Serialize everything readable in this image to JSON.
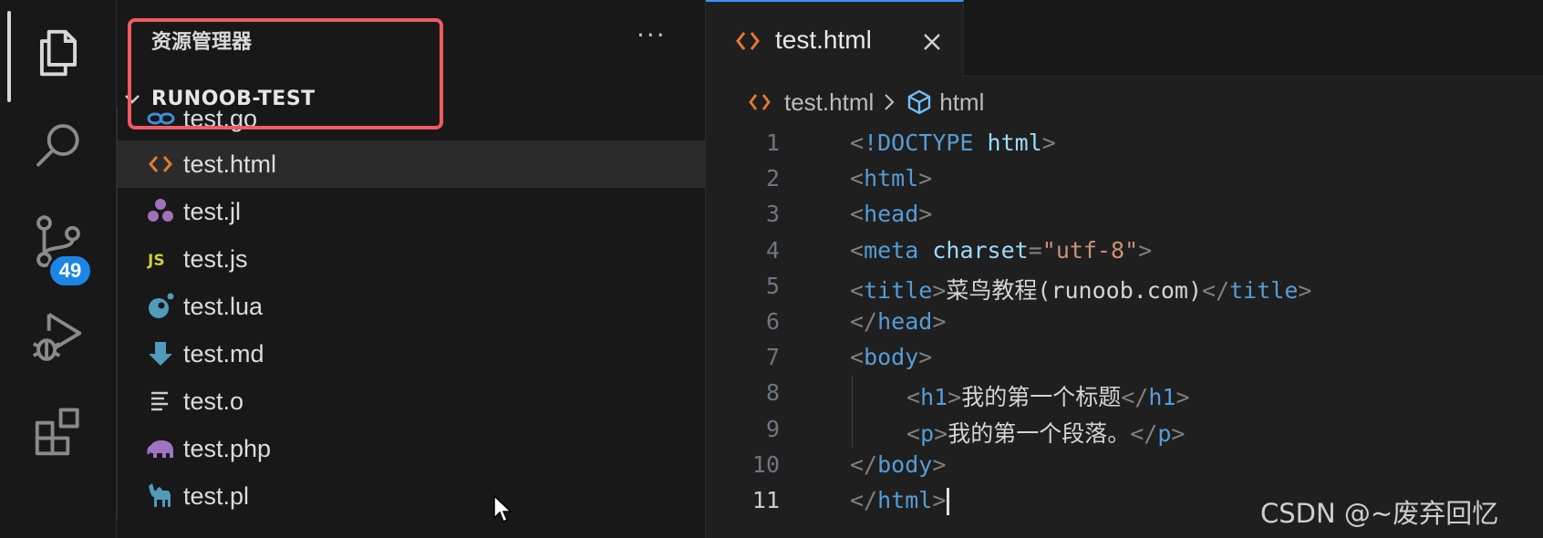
{
  "sidebar": {
    "title": "资源管理器",
    "more_label": "···",
    "folder_name": "RUNOOB-TEST",
    "files": [
      {
        "name": "test.go",
        "icon": "go-file-icon",
        "color": "#3d8fd6"
      },
      {
        "name": "test.html",
        "icon": "html-file-icon",
        "color": "#e37933"
      },
      {
        "name": "test.jl",
        "icon": "julia-file-icon",
        "color": "#a270ba"
      },
      {
        "name": "test.js",
        "icon": "javascript-file-icon",
        "color": "#cbcb41"
      },
      {
        "name": "test.lua",
        "icon": "lua-file-icon",
        "color": "#519aba"
      },
      {
        "name": "test.md",
        "icon": "markdown-file-icon",
        "color": "#519aba"
      },
      {
        "name": "test.o",
        "icon": "generic-file-icon",
        "color": "#cccccc"
      },
      {
        "name": "test.php",
        "icon": "php-file-icon",
        "color": "#a074c4"
      },
      {
        "name": "test.pl",
        "icon": "perl-file-icon",
        "color": "#519aba"
      }
    ],
    "selected_file": "test.html"
  },
  "activity_bar": {
    "items": [
      "explorer-icon",
      "search-icon",
      "source-control-icon",
      "run-debug-icon",
      "extensions-icon"
    ],
    "source_control_badge": "49"
  },
  "editor": {
    "tab_label": "test.html",
    "breadcrumb": {
      "file": "test.html",
      "symbol": "html"
    },
    "line_numbers": [
      "1",
      "2",
      "3",
      "4",
      "5",
      "6",
      "7",
      "8",
      "9",
      "10",
      "11"
    ],
    "current_line": 11,
    "code": {
      "l1_tag": "!DOCTYPE",
      "l1_attr": "html",
      "l2_tag": "html",
      "l3_tag": "head",
      "l4_tag": "meta",
      "l4_attr": "charset",
      "l4_value": "\"utf-8\"",
      "l5_tag": "title",
      "l5_text": "菜鸟教程(runoob.com)",
      "l6_tag": "head",
      "l7_tag": "body",
      "l8_tag": "h1",
      "l8_text": "我的第一个标题",
      "l9_tag": "p",
      "l9_text": "我的第一个段落。",
      "l10_tag": "body",
      "l11_tag": "html"
    }
  },
  "colors": {
    "accent": "#3794ff",
    "badge": "#1c86e6",
    "highlight_box": "#f05a62",
    "tag": "#569cd6",
    "attribute": "#9cdcfe",
    "string": "#ce9178"
  },
  "watermark": "CSDN @~废弃回忆"
}
